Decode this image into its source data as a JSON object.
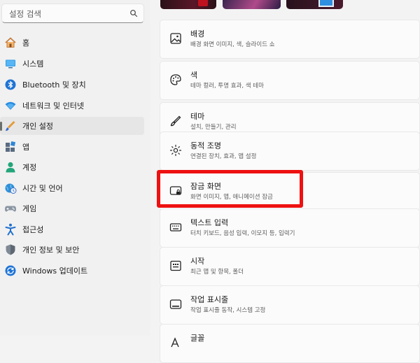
{
  "search": {
    "placeholder": "설정 검색"
  },
  "sidebar": {
    "items": [
      {
        "label": "홈",
        "icon": "home-icon",
        "selected": false
      },
      {
        "label": "시스템",
        "icon": "system-icon",
        "selected": false
      },
      {
        "label": "Bluetooth 및 장치",
        "icon": "bluetooth-icon",
        "selected": false
      },
      {
        "label": "네트워크 및 인터넷",
        "icon": "wifi-icon",
        "selected": false
      },
      {
        "label": "개인 설정",
        "icon": "brush-icon",
        "selected": true
      },
      {
        "label": "앱",
        "icon": "apps-icon",
        "selected": false
      },
      {
        "label": "계정",
        "icon": "account-icon",
        "selected": false
      },
      {
        "label": "시간 및 언어",
        "icon": "globe-clock-icon",
        "selected": false
      },
      {
        "label": "게임",
        "icon": "gamepad-icon",
        "selected": false
      },
      {
        "label": "접근성",
        "icon": "accessibility-icon",
        "selected": false
      },
      {
        "label": "개인 정보 및 보안",
        "icon": "shield-icon",
        "selected": false
      },
      {
        "label": "Windows 업데이트",
        "icon": "update-icon",
        "selected": false
      }
    ]
  },
  "main": {
    "cards": [
      {
        "title": "배경",
        "subtitle": "배경 화면 이미지, 색, 슬라이드 쇼",
        "icon": "image-icon"
      },
      {
        "title": "색",
        "subtitle": "테마 컬러, 투명 효과, 색 테마",
        "icon": "palette-icon"
      },
      {
        "title": "테마",
        "subtitle": "설치, 만들기, 관리",
        "icon": "theme-brush-icon"
      },
      {
        "title": "동적 조명",
        "subtitle": "연결된 장치, 효과, 앱 설정",
        "icon": "lighting-icon"
      },
      {
        "title": "잠금 화면",
        "subtitle": "화면 이미지, 앱, 애니메이션 잠금",
        "icon": "lock-screen-icon"
      },
      {
        "title": "텍스트 입력",
        "subtitle": "터치 키보드, 음성 입력, 이모지 등, 입력기",
        "icon": "keyboard-icon"
      },
      {
        "title": "시작",
        "subtitle": "최근 앱 및 항목, 폴더",
        "icon": "start-icon"
      },
      {
        "title": "작업 표시줄",
        "subtitle": "작업 표시줄 동작, 시스템 고정",
        "icon": "taskbar-icon"
      },
      {
        "title": "글꼴",
        "subtitle": "",
        "icon": "font-icon"
      }
    ]
  },
  "colors": {
    "highlight": "#ee1111",
    "accent_blue": "#0067c0",
    "selected_bg": "#e6e6e6"
  }
}
